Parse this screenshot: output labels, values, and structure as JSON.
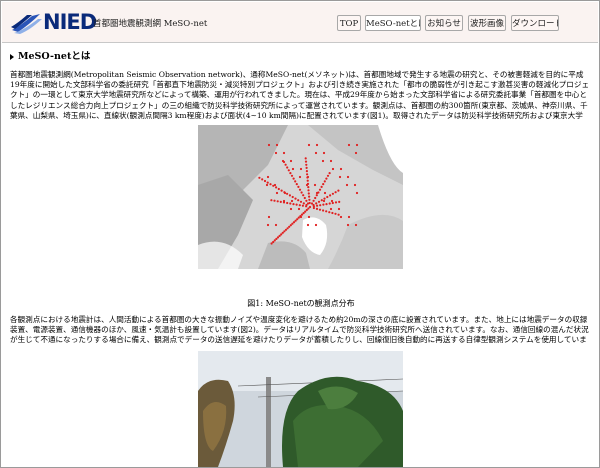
{
  "header": {
    "logo_text": "NIED",
    "site_title": "首都圏地震観測網 MeSO-net",
    "nav": [
      {
        "label": "TOP"
      },
      {
        "label": "MeSO-netとは"
      },
      {
        "label": "お知らせ"
      },
      {
        "label": "波形画像"
      },
      {
        "label": "ダウンロード"
      }
    ]
  },
  "section": {
    "title": "MeSO-netとは"
  },
  "paragraphs": [
    "首都圏地震観測網(Metropolitan Seismic Observation network)、通称MeSO-net(メソネット)は、首都圏地域で発生する地震の研究と、その被害軽減を目的に平成19年度に開始した文部科学省の委託研究「首都直下地震防災・減災特別プロジェクト」および引き続き実施された「都市の脆弱性が引き起こす激甚災害の軽減化プロジェクト」の一環として東京大学地震研究所などによって構築、運用が行われてきました。現在は、平成29年度から始まった文部科学省による研究委託事業「首都圏を中心としたレジリエンス総合力向上プロジェクト」の三の組織で防災科学技術研究所によって運営されています。観測点は、首都圏の約300箇所(東京都、茨城県、神奈川県、千葉県、山梨県、埼玉県)に、直線状(観測点間隔3 km程度)および面状(4~10 km間隔)に配置されています(図1)。取得されたデータは防災科学技術研究所および東京大学地震研究所で蓄積されています。",
    "各観測点における地震計は、人間活動による首都圏の大きな振動ノイズや温度変化を避けるため約20mの深さの底に設置されています。また、地上には地震データの収録装置、電源装置、通信機器のほか、風速・気温計も設置しています(図2)。データはリアルタイムで防災科学技術研究所へ送信されています。なお、通信回線の混んだ状況が生じて不通になったりする場合に備え、観測点でデータの送信遅延を避けたりデータが蓄積したりし、回線復旧後自動的に再送する自律型観測システムを使用しています。"
  ],
  "figure1": {
    "caption": "図1: MeSO-netの観測点分布"
  },
  "colors": {
    "header_bg": "#faf3f1",
    "logo_blue": "#0a2a7a",
    "station_red": "#e02020"
  }
}
